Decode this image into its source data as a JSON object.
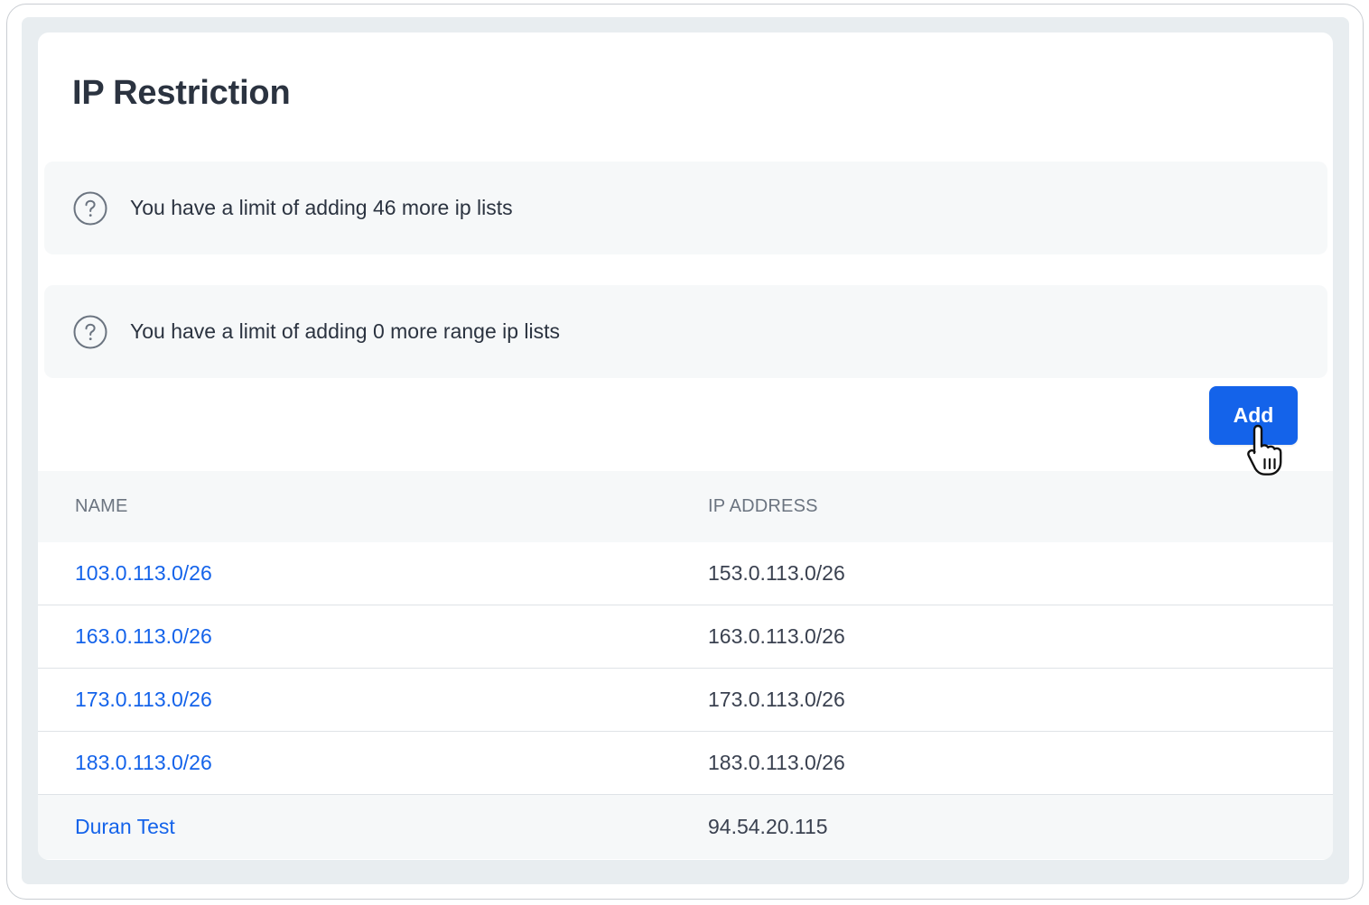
{
  "page": {
    "title": "IP Restriction"
  },
  "notices": [
    {
      "icon": "question-circle-icon",
      "text": "You have a limit of adding 46 more ip lists"
    },
    {
      "icon": "question-circle-icon",
      "text": "You have a limit of adding 0 more range ip lists"
    }
  ],
  "actions": {
    "add_label": "Add"
  },
  "table": {
    "columns": [
      "NAME",
      "IP ADDRESS"
    ],
    "rows": [
      {
        "name": "103.0.113.0/26",
        "ip": "153.0.113.0/26"
      },
      {
        "name": "163.0.113.0/26",
        "ip": "163.0.113.0/26"
      },
      {
        "name": "173.0.113.0/26",
        "ip": "173.0.113.0/26"
      },
      {
        "name": "183.0.113.0/26",
        "ip": "183.0.113.0/26"
      },
      {
        "name": "Duran Test",
        "ip": "94.54.20.115"
      }
    ]
  },
  "colors": {
    "accent": "#1463ea",
    "title": "#2b3340",
    "muted": "#6b7480",
    "panel": "#f6f8f9"
  }
}
